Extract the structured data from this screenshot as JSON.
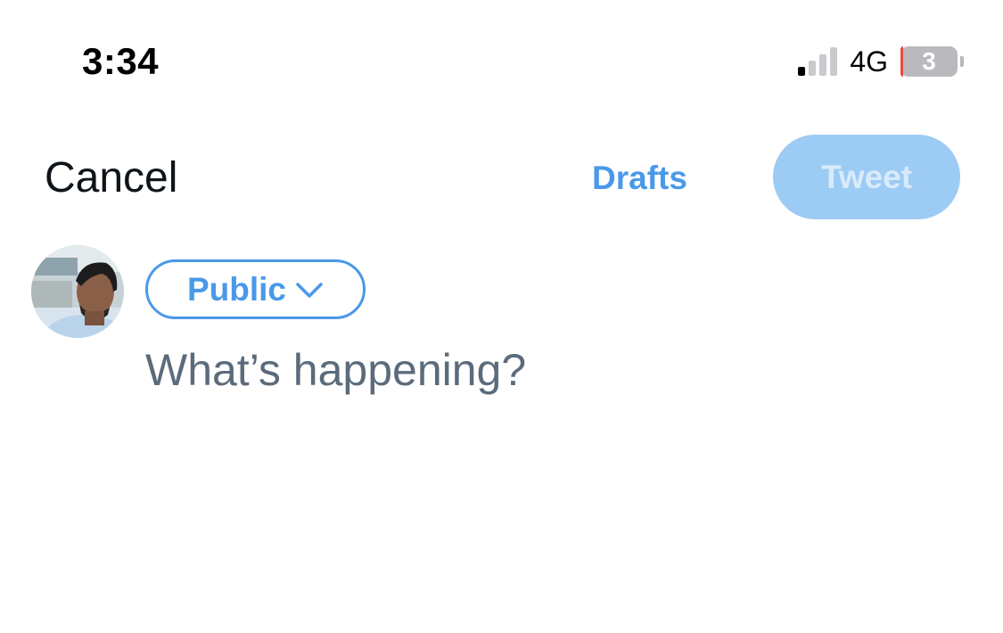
{
  "status_bar": {
    "time": "3:34",
    "network": "4G",
    "signal_bars_active": 1,
    "signal_bars_total": 4,
    "battery_level": "3",
    "battery_fill_percent": 3
  },
  "header": {
    "cancel_label": "Cancel",
    "drafts_label": "Drafts",
    "tweet_label": "Tweet",
    "tweet_enabled": false
  },
  "composer": {
    "audience_label": "Public",
    "audience_icon": "chevron-down-icon",
    "placeholder": "What’s happening?",
    "value": ""
  },
  "colors": {
    "accent": "#4a99e9",
    "tweet_button_disabled_bg": "#9ccbf4",
    "tweet_button_disabled_text": "#d8ebfb",
    "placeholder_text": "#5b6b7b",
    "battery_low": "#e8493f"
  }
}
